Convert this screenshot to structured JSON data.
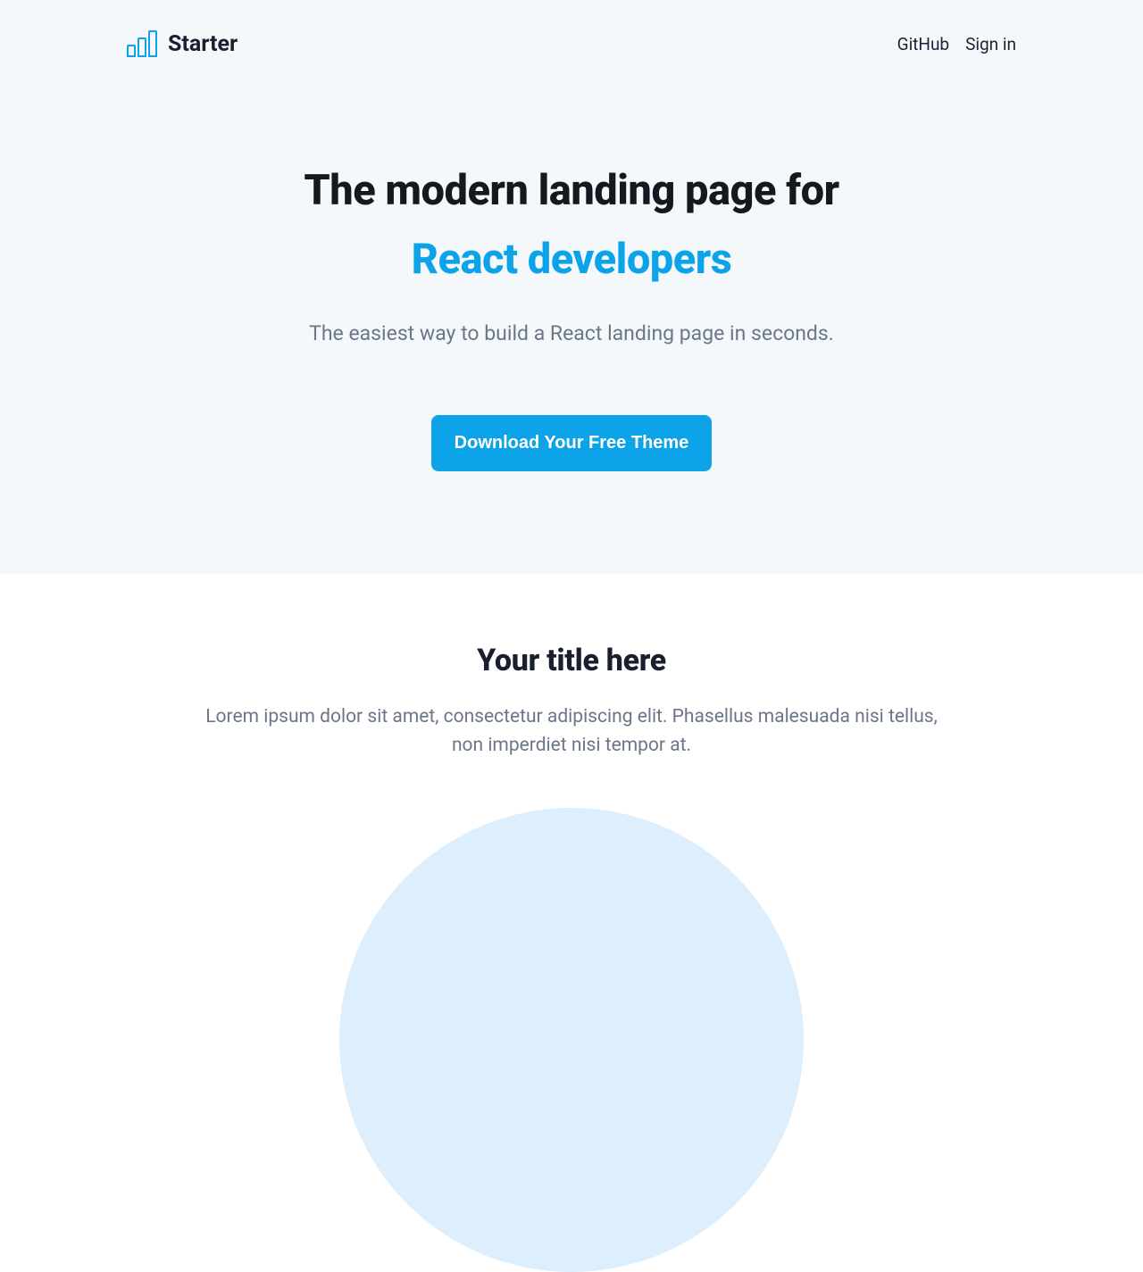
{
  "header": {
    "logo_text": "Starter",
    "nav": [
      {
        "label": "GitHub"
      },
      {
        "label": "Sign in"
      }
    ]
  },
  "hero": {
    "title_line1": "The modern landing page for",
    "title_line2": "React developers",
    "subtitle": "The easiest way to build a React landing page in seconds.",
    "cta_label": "Download Your Free Theme"
  },
  "features": {
    "title": "Your title here",
    "description": "Lorem ipsum dolor sit amet, consectetur adipiscing elit. Phasellus malesuada nisi tellus, non imperdiet nisi tempor at."
  },
  "colors": {
    "accent": "#0da3e8",
    "hero_bg": "#f4f8fb",
    "text_dark": "#1a1f2e",
    "text_muted": "#6b7789"
  }
}
